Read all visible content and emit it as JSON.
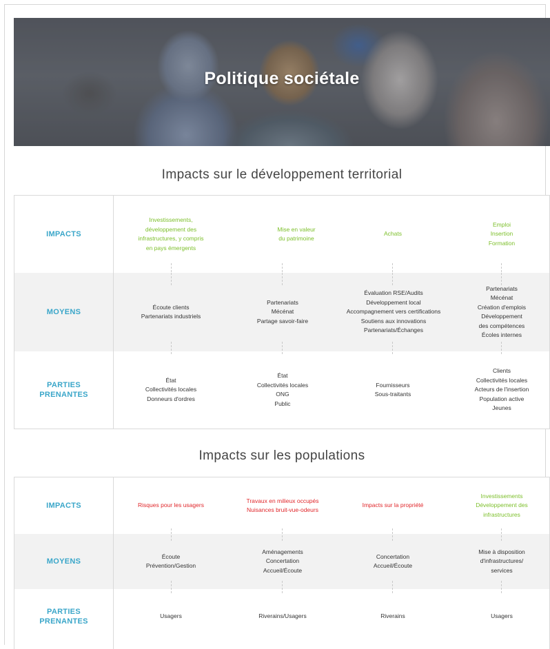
{
  "hero": {
    "title": "Politique sociétale"
  },
  "section1": {
    "heading": "Impacts sur le développement territorial",
    "labels": {
      "impacts": "IMPACTS",
      "moyens": "MOYENS",
      "parties": "PARTIES\nPRENANTES"
    },
    "impacts": [
      "Investissements,\ndéveloppement des\ninfrastructures, y compris\nen pays émergents",
      "Mise en valeur\ndu patrimoine",
      "Achats",
      "Emploi\nInsertion\nFormation"
    ],
    "moyens": [
      "Écoute clients\nPartenariats industriels",
      "Partenariats\nMécénat\nPartage savoir-faire",
      "Évaluation RSE/Audits\nDéveloppement local\nAccompagnement vers certifications\nSoutiens aux innovations\nPartenariats/Échanges",
      "Partenariats\nMécénat\nCréation d'emplois\nDéveloppement\ndes compétences\nÉcoles internes"
    ],
    "parties": [
      "État\nCollectivités locales\nDonneurs d'ordres",
      "État\nCollectivités locales\nONG\nPublic",
      "Fournisseurs\nSous-traitants",
      "Clients\nCollectivités locales\nActeurs de l'insertion\nPopulation active\nJeunes"
    ]
  },
  "section2": {
    "heading": "Impacts sur les populations",
    "labels": {
      "impacts": "IMPACTS",
      "moyens": "MOYENS",
      "parties": "PARTIES\nPRENANTES"
    },
    "impacts": [
      "Risques pour les usagers",
      "Travaux en milieux occupés\nNuisances bruit-vue-odeurs",
      "Impacts sur la propriété",
      "Investissements\nDéveloppement des\ninfrastructures"
    ],
    "moyens": [
      "Écoute\nPrévention/Gestion",
      "Aménagements\nConcertation\nAccueil/Écoute",
      "Concertation\nAccueil/Écoute",
      "Mise à disposition\nd'infrastructures/\nservices"
    ],
    "parties": [
      "Usagers",
      "Riverains/Usagers",
      "Riverains",
      "Usagers"
    ]
  },
  "colors": {
    "label": "#3aa6c9",
    "green": "#7cbf2a",
    "red": "#e0262a"
  }
}
